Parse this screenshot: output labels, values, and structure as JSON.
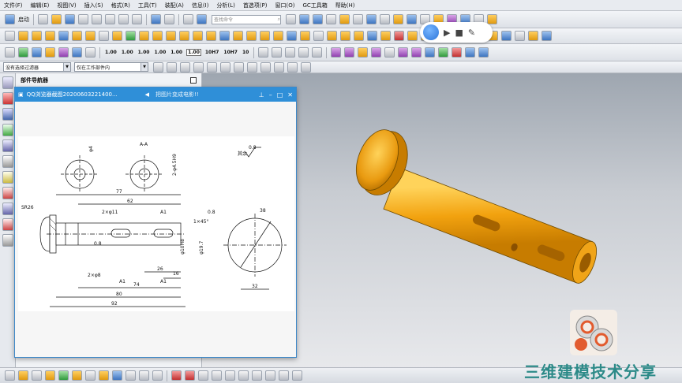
{
  "menu": [
    "文件(F)",
    "编辑(E)",
    "视图(V)",
    "插入(S)",
    "格式(R)",
    "工具(T)",
    "装配(A)",
    "信息(I)",
    "分析(L)",
    "首选项(P)",
    "窗口(O)",
    "GC工具箱",
    "帮助(H)"
  ],
  "toolbar1": {
    "start_label": "启动",
    "search_placeholder": "查找命令"
  },
  "toolbar3": {
    "tolerance_labels": [
      "1.00",
      "1.00",
      "1.00",
      "1.00",
      "1.00",
      "1.00",
      "10H7",
      "10H7",
      "10"
    ]
  },
  "filters": {
    "selection_filter": "没有选择过滤器",
    "scope": "仅在工作部件内"
  },
  "nav": {
    "title": "部件导航器"
  },
  "qq": {
    "title": "QQ浏览器截图20200603221400...",
    "extra": "把图片变成电影!!"
  },
  "drawing": {
    "section_label": "A-A",
    "sr": "SR26",
    "dims": {
      "d77": "77",
      "d62": "62",
      "d26": "26",
      "d16": "16",
      "d74": "74",
      "d80": "80",
      "d92": "92",
      "d32": "32",
      "d38": "38",
      "d4": "φ4",
      "key": "2-φ4.5H9",
      "hole": "2×φ11",
      "chamfer": "1×45°",
      "dia1": "φ19.7",
      "dia2": "φ10H8",
      "two_phi": "2×φ8",
      "a1": "A1",
      "rough": "0.8",
      "rest": "其余"
    }
  },
  "watermark": {
    "text": "三维建模技术分享"
  },
  "colors": {
    "part_main": "#f2a20f",
    "part_dark": "#c77c00",
    "part_light": "#ffd35a",
    "qq_title": "#2f8fd8",
    "watermark": "#2c8a88"
  }
}
